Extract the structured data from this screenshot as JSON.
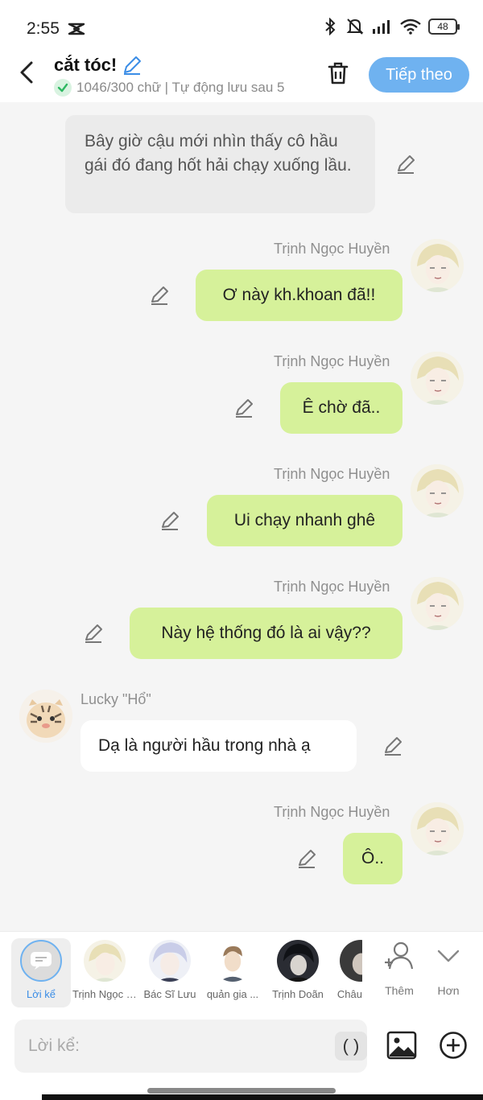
{
  "status_bar": {
    "time": "2:55",
    "battery": "48"
  },
  "header": {
    "title": "cắt tóc!",
    "subtitle": "1046/300 chữ | Tự động lưu sau 5",
    "next_label": "Tiếp theo"
  },
  "messages": {
    "narration": "Bây giờ cậu mới nhìn thấy cô hầu gái đó đang hốt hải chạy xuống lầu.",
    "m1": {
      "sender": "Trịnh Ngọc Huyền",
      "text": "Ơ này kh.khoan đã!!"
    },
    "m2": {
      "sender": "Trịnh Ngọc Huyền",
      "text": "Ê chờ đã.."
    },
    "m3": {
      "sender": "Trịnh Ngọc Huyền",
      "text": "Ui chạy nhanh ghê"
    },
    "m4": {
      "sender": "Trịnh Ngọc Huyền",
      "text": "Này hệ thống đó là ai vậy??"
    },
    "m5": {
      "sender": "Lucky \"Hổ\"",
      "text": "Dạ là người hầu trong nhà ạ"
    },
    "m6": {
      "sender": "Trịnh Ngọc Huyền",
      "text": "Ô.."
    }
  },
  "characters": [
    {
      "label": "Lời kể"
    },
    {
      "label": "Trịnh Ngọc Huyền"
    },
    {
      "label": "Bác Sĩ Lưu"
    },
    {
      "label": "quản gia ..."
    },
    {
      "label": "Trịnh Doãn"
    },
    {
      "label": "Châu"
    }
  ],
  "tools": {
    "add_label": "Thêm",
    "more_label": "Hơn"
  },
  "input": {
    "placeholder": "Lời kể:",
    "paren_label": "( )"
  },
  "colors": {
    "accent": "#6fb2f0",
    "user_bubble": "#d6f19a",
    "other_bubble": "#ffffff",
    "narration_bubble": "#ebebeb"
  },
  "icons": {
    "back": "chevron-left-icon",
    "edit": "pencil-icon",
    "trash": "trash-icon",
    "image": "image-icon",
    "plus": "plus-circle-icon",
    "add_person": "add-person-icon",
    "more": "chevron-down-icon"
  }
}
